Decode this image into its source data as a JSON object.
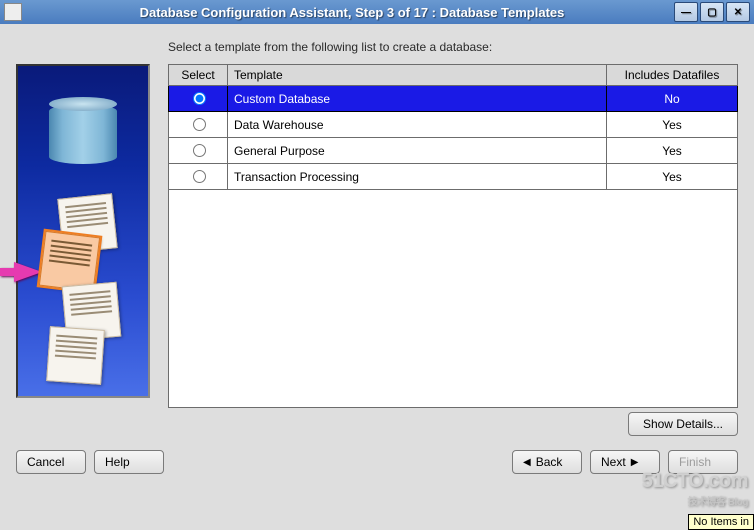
{
  "window": {
    "title": "Database Configuration Assistant, Step 3 of 17 : Database Templates"
  },
  "instruction": "Select a template from the following list to create a database:",
  "table": {
    "headers": {
      "select": "Select",
      "template": "Template",
      "includes": "Includes Datafiles"
    },
    "rows": [
      {
        "selected": true,
        "template": "Custom Database",
        "includes": "No"
      },
      {
        "selected": false,
        "template": "Data Warehouse",
        "includes": "Yes"
      },
      {
        "selected": false,
        "template": "General Purpose",
        "includes": "Yes"
      },
      {
        "selected": false,
        "template": "Transaction Processing",
        "includes": "Yes"
      }
    ]
  },
  "buttons": {
    "show_details": "Show Details...",
    "cancel": "Cancel",
    "help": "Help",
    "back": "Back",
    "next": "Next",
    "finish": "Finish"
  },
  "watermark": {
    "main": "51CTO.com",
    "sub": "技术博客  Blog"
  },
  "tooltip": "No Items in "
}
